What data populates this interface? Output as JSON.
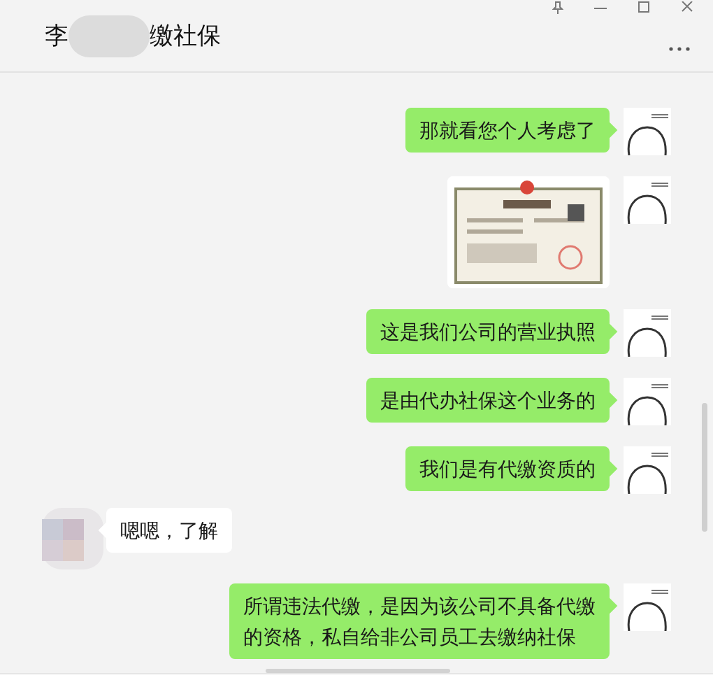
{
  "window": {
    "title_start": "李",
    "title_end": "缴社保"
  },
  "messages": [
    {
      "kind": "text",
      "outgoing": true,
      "text": "那就看您个人考虑了"
    },
    {
      "kind": "picture",
      "outgoing": true
    },
    {
      "kind": "text",
      "outgoing": true,
      "text": "这是我们公司的营业执照"
    },
    {
      "kind": "text",
      "outgoing": true,
      "text": "是由代办社保这个业务的"
    },
    {
      "kind": "text",
      "outgoing": true,
      "text": "我们是有代缴资质的"
    },
    {
      "kind": "text",
      "outgoing": false,
      "text": "嗯嗯，了解"
    },
    {
      "kind": "text",
      "outgoing": true,
      "text": "所谓违法代缴，是因为该公司不具备代缴的资格，私自给非公司员工去缴纳社保"
    }
  ]
}
